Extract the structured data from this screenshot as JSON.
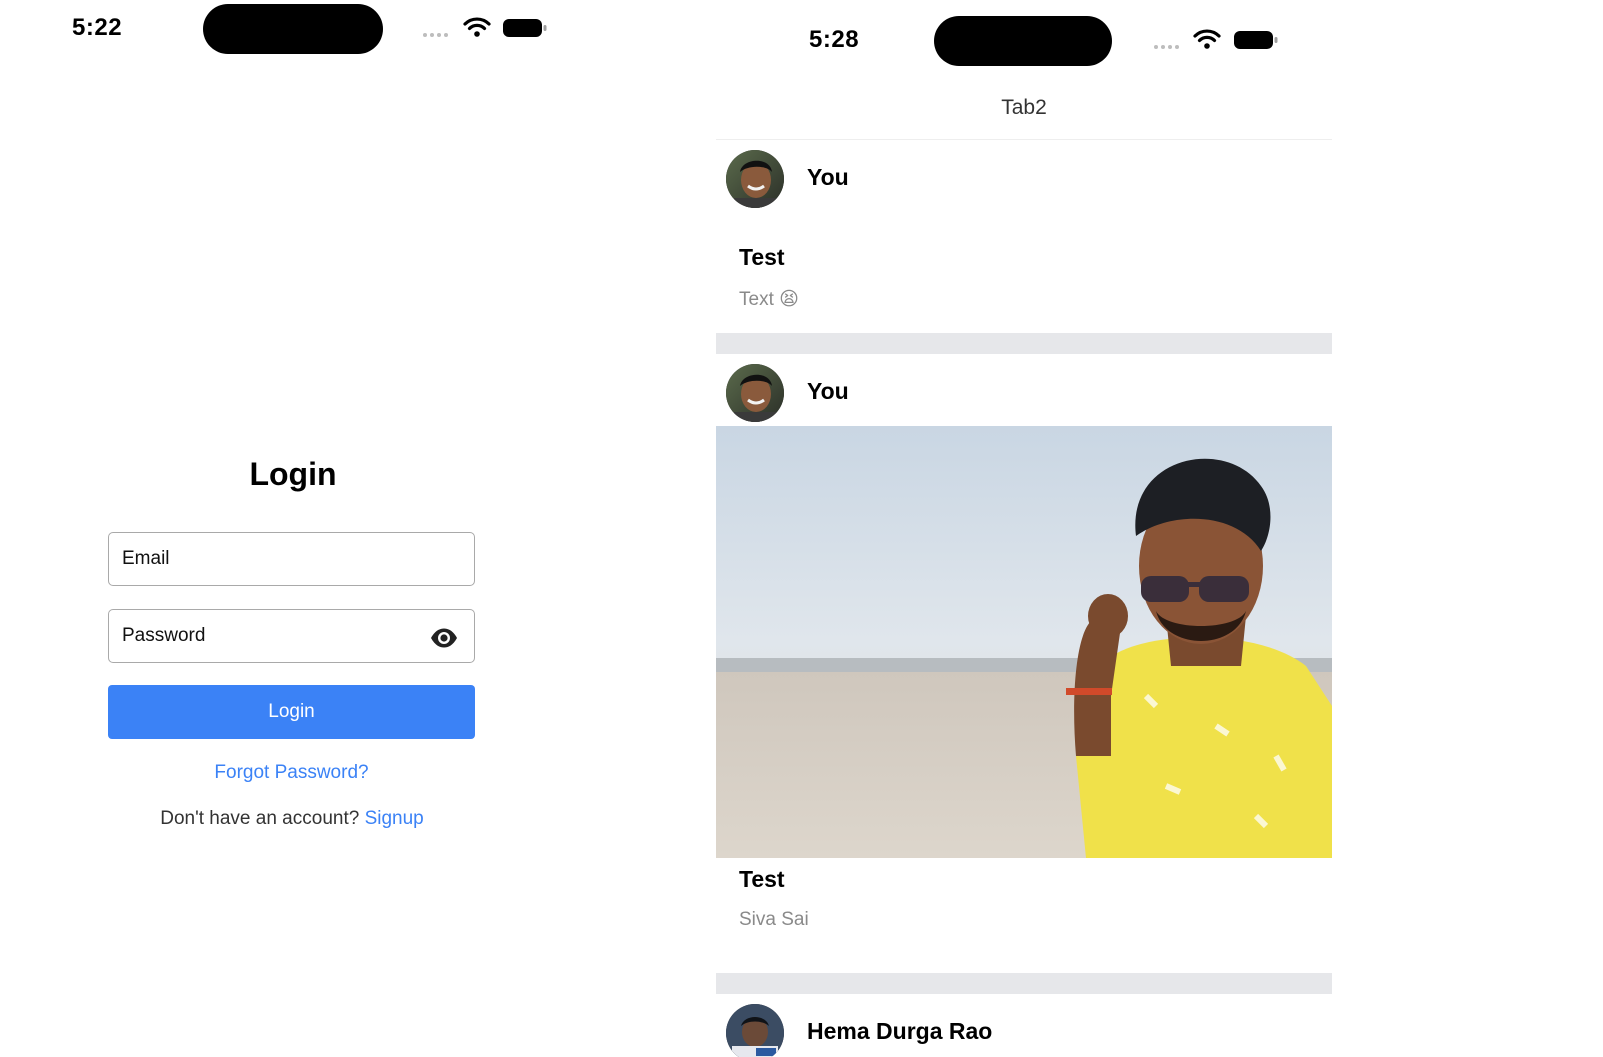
{
  "login_screen": {
    "status_bar": {
      "time": "5:22"
    },
    "title": "Login",
    "email": {
      "placeholder": "Email",
      "value": ""
    },
    "password": {
      "placeholder": "Password",
      "value": ""
    },
    "login_button_label": "Login",
    "forgot_password_label": "Forgot Password?",
    "signup_prompt": "Don't have an account?",
    "signup_label": "Signup",
    "accent_color": "#3b82f6"
  },
  "feed_screen": {
    "status_bar": {
      "time": "5:28"
    },
    "header_title": "Tab2",
    "posts": [
      {
        "author": "You",
        "title": "Test",
        "subtitle": "Text 😫",
        "has_image": false
      },
      {
        "author": "You",
        "title": "Test",
        "subtitle": "Siva Sai",
        "has_image": true
      },
      {
        "author": "Hema Durga Rao"
      }
    ]
  }
}
